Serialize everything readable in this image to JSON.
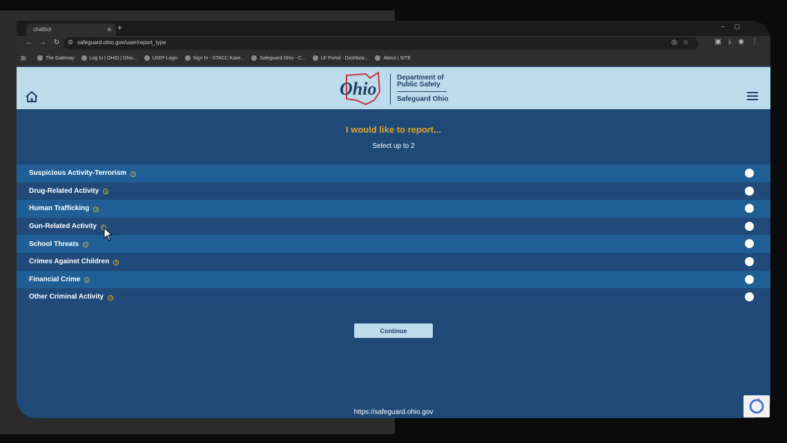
{
  "browser": {
    "tab_title": "chatbot",
    "url": "safeguard.ohio.gov/user/report_type",
    "bookmarks": [
      {
        "label": "The Gateway"
      },
      {
        "label": "Log In | OHID | Ohio..."
      },
      {
        "label": "LEEP Login"
      },
      {
        "label": "Sign In - STACC Kase..."
      },
      {
        "label": "Safeguard Ohio - C..."
      },
      {
        "label": "LE Portal - Dashboa..."
      },
      {
        "label": "About | SITE"
      }
    ]
  },
  "header": {
    "logo_text": "Ohio",
    "dept_line1": "Department of",
    "dept_line2": "Public Safety",
    "subbrand": "Safeguard Ohio"
  },
  "main": {
    "heading": "I would like to report...",
    "subheading": "Select up to 2",
    "options": [
      {
        "label": "Suspicious Activity-Terrorism"
      },
      {
        "label": "Drug-Related Activity"
      },
      {
        "label": "Human Trafficking"
      },
      {
        "label": "Gun-Related Activity"
      },
      {
        "label": "School Threats"
      },
      {
        "label": "Crimes Against Children"
      },
      {
        "label": "Financial Crime"
      },
      {
        "label": "Other Criminal Activity"
      }
    ],
    "continue_label": "Continue"
  },
  "footer": {
    "url": "https://safeguard.ohio.gov"
  },
  "colors": {
    "page_bg": "#1f4a78",
    "header_bg": "#bcdcec",
    "accent": "#e3a52b",
    "row_light": "#1f5f95",
    "row_dark": "#214a7a"
  }
}
